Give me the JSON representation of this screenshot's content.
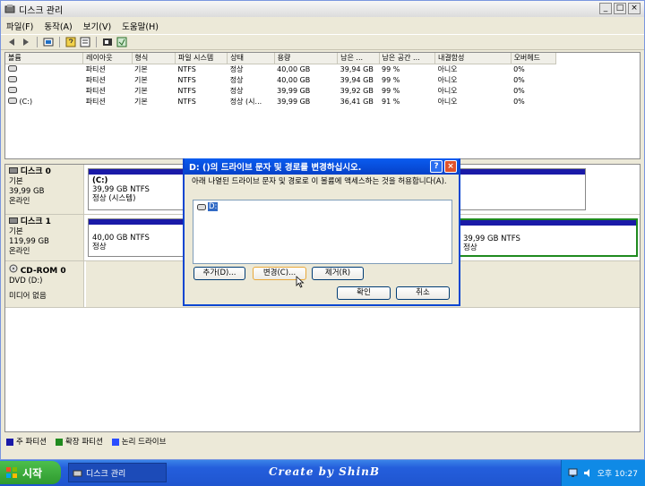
{
  "window": {
    "title": "디스크 관리",
    "min": "_",
    "max": "□",
    "close": "×"
  },
  "menu": [
    "파일(F)",
    "동작(A)",
    "보기(V)",
    "도움말(H)"
  ],
  "toolbar_icons": [
    "back-icon",
    "forward-icon",
    "console-icon",
    "help-icon",
    "properties-icon",
    "refresh-icon",
    "settings-icon",
    "export-icon"
  ],
  "volumes": {
    "headers": [
      "볼륨",
      "레이아웃",
      "형식",
      "파일 시스템",
      "상태",
      "용량",
      "남은 ...",
      "남은 공간 ...",
      "내결함성",
      "오버헤드"
    ],
    "rows": [
      [
        "",
        "파티션",
        "기본",
        "NTFS",
        "정상",
        "40,00 GB",
        "39,94 GB",
        "99 %",
        "아니오",
        "0%"
      ],
      [
        "",
        "파티션",
        "기본",
        "NTFS",
        "정상",
        "40,00 GB",
        "39,94 GB",
        "99 %",
        "아니오",
        "0%"
      ],
      [
        "",
        "파티션",
        "기본",
        "NTFS",
        "정상",
        "39,99 GB",
        "39,92 GB",
        "99 %",
        "아니오",
        "0%"
      ],
      [
        "(C:)",
        "파티션",
        "기본",
        "NTFS",
        "정상 (시...",
        "39,99 GB",
        "36,41 GB",
        "91 %",
        "아니오",
        "0%"
      ]
    ]
  },
  "disks": [
    {
      "name": "디스크 0",
      "type": "기본",
      "size": "39,99 GB",
      "status": "온라인",
      "part_title": "(C:)",
      "part_size": "39,99 GB NTFS",
      "part_status": "정상 (시스템)"
    },
    {
      "name": "디스크 1",
      "type": "기본",
      "size": "119,99 GB",
      "status": "온라인",
      "part1_size": "40,00 GB NTFS",
      "part1_status": "정상",
      "part2_size": "39,99 GB NTFS",
      "part2_status": "정상"
    },
    {
      "name": "CD-ROM 0",
      "type": "DVD (D:)",
      "size": "",
      "status": "미디어 없음"
    }
  ],
  "legend": [
    {
      "label": "주 파티션",
      "color": "#1a1aa8"
    },
    {
      "label": "확장 파티션",
      "color": "#1f8a1f"
    },
    {
      "label": "논리 드라이브",
      "color": "#2a4dff"
    }
  ],
  "dialog": {
    "title": "D: ()의 드라이브 문자 및 경로를 변경하십시오.",
    "message": "아래 나열된 드라이브 문자 및 경로로 이 볼륨에 액세스하는 것을 허용합니다(A).",
    "item": "D:",
    "add": "추가(D)...",
    "change": "변경(C)...",
    "remove": "제거(R)",
    "ok": "확인",
    "cancel": "취소",
    "help": "?",
    "close": "×"
  },
  "taskbar": {
    "start": "시작",
    "task": "디스크 관리",
    "brand": "Create by ShinB",
    "clock": "오후 10:27"
  }
}
